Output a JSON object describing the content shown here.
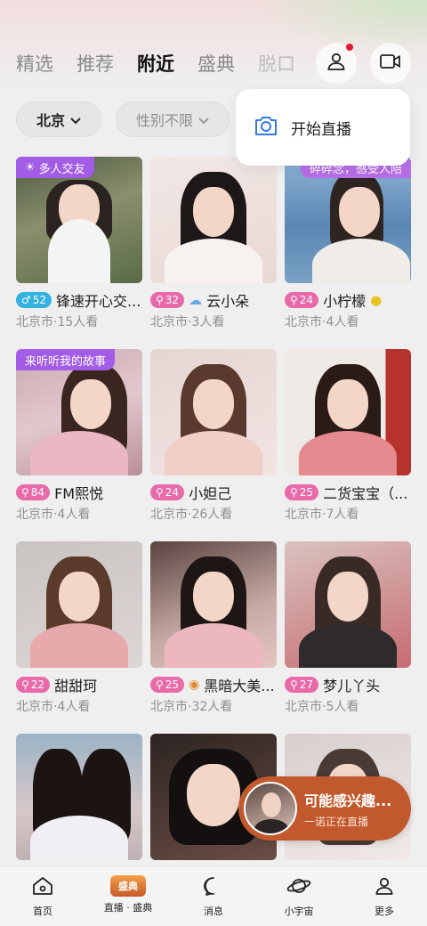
{
  "header": {
    "tabs": [
      {
        "label": "精选"
      },
      {
        "label": "推荐"
      },
      {
        "label": "附近"
      },
      {
        "label": "盛典"
      },
      {
        "label": "脱口"
      }
    ],
    "active_tab": "附近",
    "profile_icon": "person-icon",
    "video_icon": "video-camera-icon",
    "notification_color": "#e5192d"
  },
  "filters": {
    "city": "北京",
    "gender": "性别不限"
  },
  "popup_menu": {
    "item_label": "开始直播",
    "item_icon": "camera-icon"
  },
  "streams": [
    {
      "tag": "多人交友",
      "tag_icon": "sun-icon",
      "badge_type": "male",
      "level": "52",
      "name": "锋速开心交...",
      "city": "北京市",
      "viewers": "15人看"
    },
    {
      "tag": "",
      "badge_type": "female",
      "level": "32",
      "name_icon": "cloud-icon",
      "name": "云小朵",
      "city": "北京市",
      "viewers": "3人看"
    },
    {
      "tag": "碎碎念，感受人陪",
      "badge_type": "female",
      "level": "24",
      "name": "小柠檬",
      "name_suffix_icon": "lemon-icon",
      "city": "北京市",
      "viewers": "4人看"
    },
    {
      "tag": "来听听我的故事",
      "badge_type": "female",
      "level": "84",
      "name": "FM熙悦",
      "city": "北京市",
      "viewers": "4人看"
    },
    {
      "tag": "",
      "badge_type": "female",
      "level": "24",
      "name": "小妲己",
      "city": "北京市",
      "viewers": "26人看"
    },
    {
      "tag": "",
      "badge_type": "female",
      "level": "25",
      "name": "二货宝宝（...",
      "city": "北京市",
      "viewers": "7人看"
    },
    {
      "tag": "",
      "badge_type": "female",
      "level": "22",
      "name": "甜甜珂",
      "city": "北京市",
      "viewers": "4人看"
    },
    {
      "tag": "",
      "badge_type": "female",
      "level": "25",
      "name_icon": "tiger-icon",
      "name": "黑暗大美...",
      "city": "北京市",
      "viewers": "32人看"
    },
    {
      "tag": "",
      "badge_type": "female",
      "level": "27",
      "name": "梦儿丫头",
      "city": "北京市",
      "viewers": "5人看"
    }
  ],
  "floating_recommendation": {
    "title": "可能感兴趣...",
    "subtitle": "一诺正在直播"
  },
  "bottom_nav": [
    {
      "label": "首页",
      "icon": "home-icon"
    },
    {
      "label": "直播 · 盛典",
      "icon": "live-logo-icon",
      "logo_text": "盛典"
    },
    {
      "label": "消息",
      "icon": "message-icon"
    },
    {
      "label": "小宇宙",
      "icon": "planet-icon"
    },
    {
      "label": "更多",
      "icon": "more-person-icon"
    }
  ],
  "colors": {
    "tag_purple": "#a35ce6",
    "badge_female": "#e86aa9",
    "badge_male": "#35b2e0",
    "float_card": "#c2592e"
  }
}
